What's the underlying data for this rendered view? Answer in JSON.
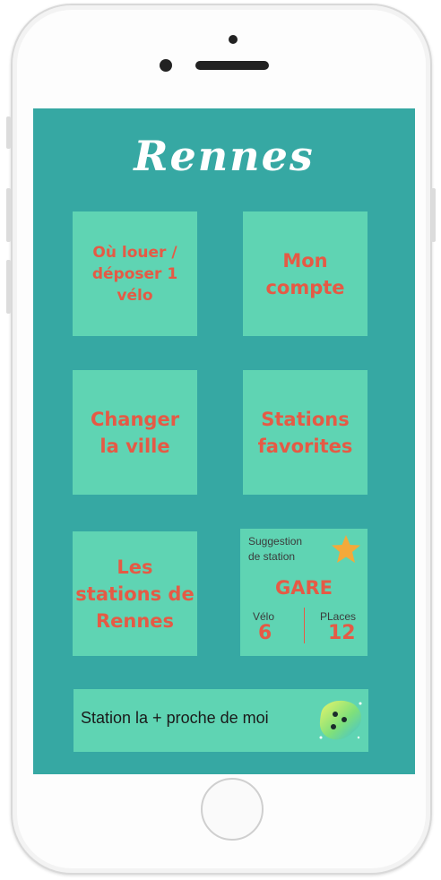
{
  "app": {
    "city": "Rennes"
  },
  "tiles": {
    "rent": "Où louer /\ndéposer 1\nvélo",
    "account": "Mon\ncompte",
    "change_city": "Changer\nla ville",
    "favorites": "Stations\nfavorites",
    "stations": "Les\nstations de\nRennes"
  },
  "suggestion": {
    "label": "Suggestion\nde station",
    "station": "GARE",
    "bikes_label": "Vélo",
    "bikes_value": "6",
    "places_label": "PLaces",
    "places_value": "12"
  },
  "nearest": {
    "label": "Station la + proche de moi"
  },
  "colors": {
    "background": "#36a8a3",
    "tile": "#5fd4b3",
    "accent_text": "#e55a45",
    "star": "#f4a93a"
  },
  "icons": {
    "star": "star-icon",
    "locate": "blob-locator-icon"
  }
}
